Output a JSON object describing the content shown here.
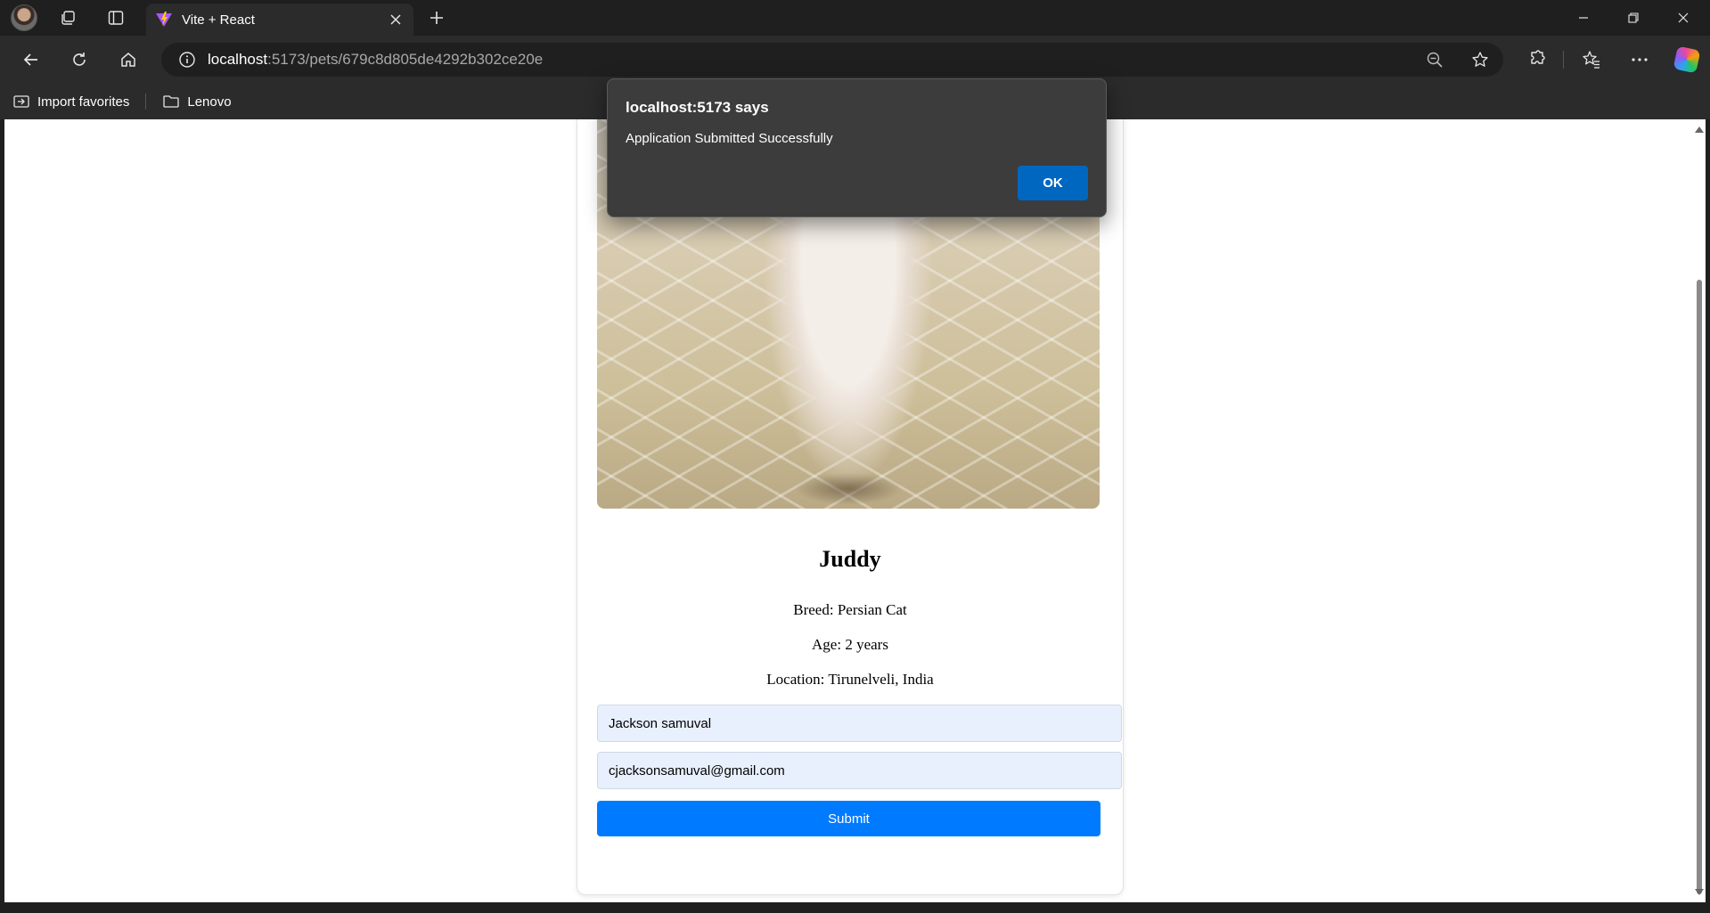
{
  "browser": {
    "tab": {
      "title": "Vite + React"
    },
    "address": {
      "host": "localhost",
      "rest": ":5173/pets/679c8d805de4292b302ce20e"
    },
    "favorites": [
      {
        "label": "Import favorites"
      },
      {
        "label": "Lenovo"
      }
    ]
  },
  "pet": {
    "name": "Juddy",
    "breed": "Breed: Persian Cat",
    "age": "Age: 2 years",
    "location": "Location: Tirunelveli, India"
  },
  "form": {
    "name_value": "Jackson samuval",
    "email_value": "cjacksonsamuval@gmail.com",
    "submit_label": "Submit"
  },
  "dialog": {
    "title": "localhost:5173 says",
    "message": "Application Submitted Successfully",
    "ok_label": "OK"
  },
  "colors": {
    "submit": "#007bff",
    "dialog_ok": "#0067c0",
    "chrome_dark": "#1f1f1f",
    "chrome": "#2b2b2b"
  }
}
